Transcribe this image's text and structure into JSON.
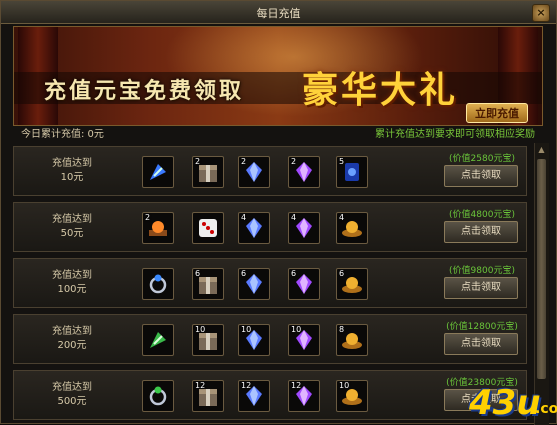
{
  "window": {
    "title": "每日充值",
    "close_label": "×"
  },
  "banner": {
    "slogan": "充值元宝免费领取",
    "big_text": "豪华大礼",
    "button": "立即充值"
  },
  "info": {
    "total_label": "今日累计充值: 0元",
    "notice": "累计充值达到要求即可领取相应奖励"
  },
  "rows": [
    {
      "cond1": "充值达到",
      "cond2": "10元",
      "value": "(价值2580元宝)",
      "button": "点击领取",
      "items": [
        {
          "count": "",
          "icon": "blue-feather-icon"
        },
        {
          "count": "2",
          "icon": "gift-box-icon"
        },
        {
          "count": "2",
          "icon": "blue-crystal-icon"
        },
        {
          "count": "2",
          "icon": "purple-crystal-icon"
        },
        {
          "count": "5",
          "icon": "blue-scroll-icon"
        }
      ]
    },
    {
      "cond1": "充值达到",
      "cond2": "50元",
      "value": "(价值4800元宝)",
      "button": "点击领取",
      "items": [
        {
          "count": "2",
          "icon": "orange-orb-icon"
        },
        {
          "count": "",
          "icon": "dice-icon"
        },
        {
          "count": "4",
          "icon": "blue-crystal-icon"
        },
        {
          "count": "4",
          "icon": "purple-crystal-icon"
        },
        {
          "count": "4",
          "icon": "gold-ingot-icon"
        }
      ]
    },
    {
      "cond1": "充值达到",
      "cond2": "100元",
      "value": "(价值9800元宝)",
      "button": "点击领取",
      "items": [
        {
          "count": "",
          "icon": "blue-ring-icon"
        },
        {
          "count": "6",
          "icon": "gift-box-icon"
        },
        {
          "count": "6",
          "icon": "blue-crystal-icon"
        },
        {
          "count": "6",
          "icon": "purple-crystal-icon"
        },
        {
          "count": "6",
          "icon": "gold-ingot-icon"
        }
      ]
    },
    {
      "cond1": "充值达到",
      "cond2": "200元",
      "value": "(价值12800元宝)",
      "button": "点击领取",
      "items": [
        {
          "count": "",
          "icon": "green-feather-icon"
        },
        {
          "count": "10",
          "icon": "gift-box-icon"
        },
        {
          "count": "10",
          "icon": "blue-crystal-icon"
        },
        {
          "count": "10",
          "icon": "purple-crystal-icon"
        },
        {
          "count": "8",
          "icon": "gold-ingot-icon"
        }
      ]
    },
    {
      "cond1": "充值达到",
      "cond2": "500元",
      "value": "(价值23800元宝)",
      "button": "点击领取",
      "items": [
        {
          "count": "",
          "icon": "green-ring-icon"
        },
        {
          "count": "12",
          "icon": "gift-box-icon"
        },
        {
          "count": "12",
          "icon": "blue-crystal-icon"
        },
        {
          "count": "12",
          "icon": "purple-crystal-icon"
        },
        {
          "count": "10",
          "icon": "gold-ingot-icon"
        }
      ]
    }
  ],
  "watermark": {
    "brand": "43u",
    "suffix": ".com"
  },
  "colors": {
    "accent": "#ffd23a",
    "value_green": "#6ac53a",
    "frame": "#5a4a32"
  }
}
